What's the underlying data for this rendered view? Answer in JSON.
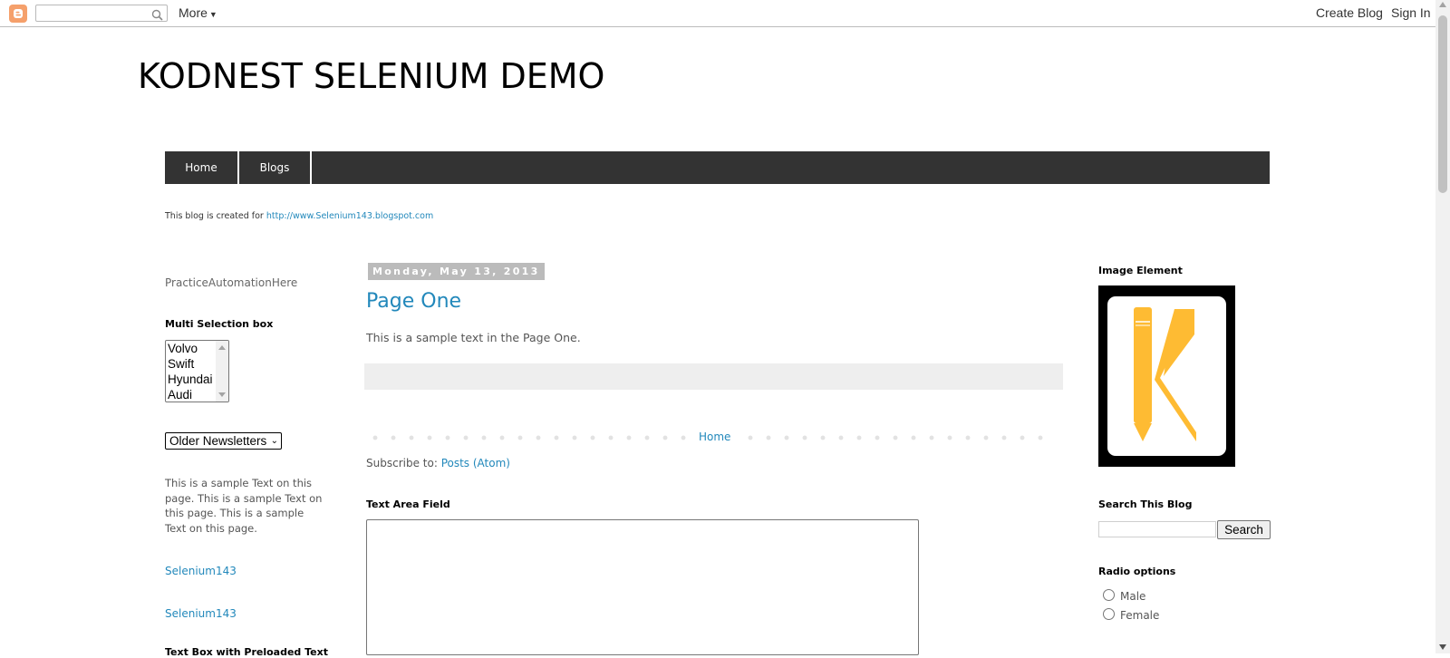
{
  "navbar": {
    "more_label": "More",
    "create_blog": "Create Blog",
    "sign_in": "Sign In"
  },
  "header": {
    "title": "KODNEST SELENIUM DEMO",
    "tabs": [
      {
        "label": "Home"
      },
      {
        "label": "Blogs"
      }
    ],
    "description_prefix": "This blog is created for ",
    "description_link": "http://www.Selenium143.blogspot.com"
  },
  "left_sidebar": {
    "practice_text": "PracticeAutomationHere",
    "multi_select_title": "Multi Selection box",
    "multi_select_options": [
      "Volvo",
      "Swift",
      "Hyundai",
      "Audi"
    ],
    "newsletter_selected": "Older Newsletters",
    "sample_text": "This is a sample Text on this page. This is a sample Text on this page. This is a sample Text on this page.",
    "links": [
      "Selenium143",
      "Selenium143"
    ],
    "preloaded_title": "Text Box with Preloaded Text"
  },
  "main": {
    "date": "Monday, May 13, 2013",
    "post_title": "Page One",
    "post_body": "This is a sample text in the Page One.",
    "home_link": "Home",
    "subscribe_prefix": "Subscribe to: ",
    "subscribe_link": "Posts (Atom)",
    "textarea_title": "Text Area Field"
  },
  "right_sidebar": {
    "image_title": "Image Element",
    "search_title": "Search This Blog",
    "search_button": "Search",
    "radio_title": "Radio options",
    "radio_options": [
      "Male",
      "Female"
    ]
  },
  "colors": {
    "link": "#2288bb",
    "tab_bar": "#333333",
    "date_header_bg": "#bbbbbb",
    "logo_orange": "#febb33"
  },
  "icons": [
    "blogger-logo-icon",
    "search-icon",
    "caret-down-icon"
  ]
}
